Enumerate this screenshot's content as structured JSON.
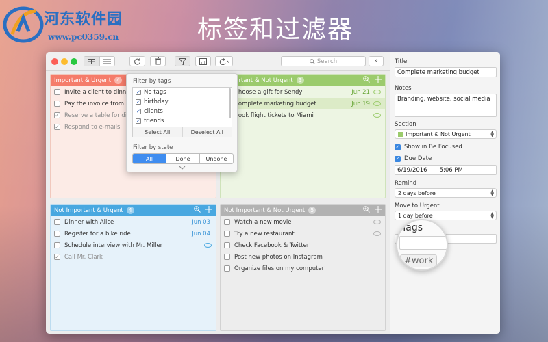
{
  "watermark": {
    "site_name": "河东软件园",
    "url": "www.pc0359.cn"
  },
  "banner": {
    "title": "标签和过滤器"
  },
  "toolbar": {
    "search_placeholder": "Search"
  },
  "colors": {
    "red": "#f57c6a",
    "green": "#9bcb6c",
    "blue": "#49a8e0",
    "gray": "#b2b2b2"
  },
  "quadrants": [
    {
      "title": "Important & Urgent",
      "count": "4",
      "items": [
        {
          "text": "Invite a client to dinner",
          "done": false,
          "date": "",
          "note": false
        },
        {
          "text": "Pay the invoice from H",
          "done": false,
          "date": "",
          "note": false
        },
        {
          "text": "Reserve a table for din",
          "done": true,
          "date": "",
          "note": false
        },
        {
          "text": "Respond to e-mails",
          "done": true,
          "date": "",
          "note": false
        }
      ]
    },
    {
      "title": "Important & Not Urgent",
      "count": "3",
      "items": [
        {
          "text": "Choose a gift for Sendy",
          "done": false,
          "date": "Jun 21",
          "note": true
        },
        {
          "text": "Complete marketing budget",
          "done": false,
          "date": "Jun 19",
          "note": true
        },
        {
          "text": "Book flight tickets to Miami",
          "done": false,
          "date": "",
          "note": true
        }
      ]
    },
    {
      "title": "Not Important & Urgent",
      "count": "4",
      "items": [
        {
          "text": "Dinner with Alice",
          "done": false,
          "date": "Jun 03",
          "note": false
        },
        {
          "text": "Register for a bike ride",
          "done": false,
          "date": "Jun 04",
          "note": false
        },
        {
          "text": "Schedule interview with Mr. Miller",
          "done": false,
          "date": "",
          "note": true
        },
        {
          "text": "Call Mr. Clark",
          "done": true,
          "date": "",
          "note": false
        }
      ]
    },
    {
      "title": "Not Important & Not Urgent",
      "count": "5",
      "items": [
        {
          "text": "Watch a new movie",
          "done": false,
          "date": "",
          "note": true
        },
        {
          "text": "Try a new restaurant",
          "done": false,
          "date": "",
          "note": true
        },
        {
          "text": "Check Facebook & Twitter",
          "done": false,
          "date": "",
          "note": false
        },
        {
          "text": "Post new photos on Instagram",
          "done": false,
          "date": "",
          "note": false
        },
        {
          "text": "Organize files on my computer",
          "done": false,
          "date": "",
          "note": false
        }
      ]
    }
  ],
  "filter_popover": {
    "tags_heading": "Filter by tags",
    "tags": [
      {
        "label": "No tags",
        "checked": true
      },
      {
        "label": "birthday",
        "checked": true
      },
      {
        "label": "clients",
        "checked": true
      },
      {
        "label": "friends",
        "checked": true
      }
    ],
    "select_all": "Select All",
    "deselect_all": "Deselect All",
    "state_heading": "Filter by state",
    "states": [
      "All",
      "Done",
      "Undone"
    ],
    "selected_state": "All"
  },
  "detail": {
    "title_label": "Title",
    "title_value": "Complete marketing budget",
    "notes_label": "Notes",
    "notes_value": "Branding, website, social media",
    "section_label": "Section",
    "section_value": "Important & Not Urgent",
    "show_focused": "Show in Be Focused",
    "due_date_label": "Due Date",
    "date_value": "6/19/2016",
    "time_value": "5:06 PM",
    "remind_label": "Remind",
    "remind_value": "2 days before",
    "move_label": "Move to Urgent",
    "move_value": "1 day before",
    "tags_label": "Tags",
    "tag_chip": "#work"
  }
}
